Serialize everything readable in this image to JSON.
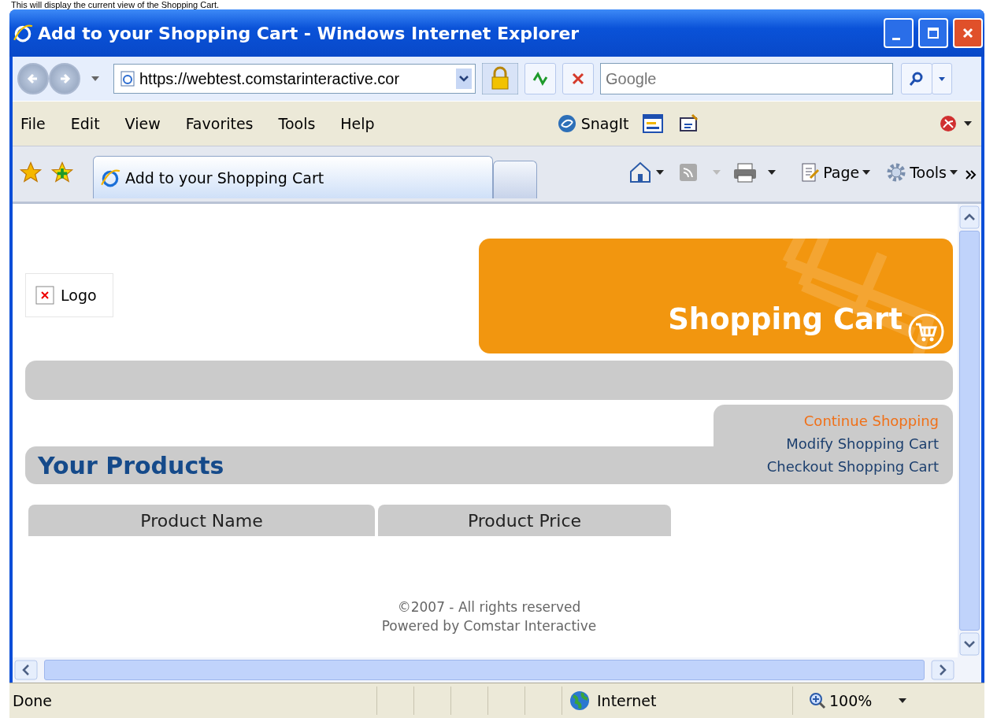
{
  "caption": "This will display the current view of the Shopping Cart.",
  "window": {
    "title": "Add to your Shopping Cart - Windows Internet Explorer"
  },
  "address_bar": {
    "url": "https://webtest.comstarinteractive.cor",
    "search_placeholder": "Google"
  },
  "menu": [
    "File",
    "Edit",
    "View",
    "Favorites",
    "Tools",
    "Help"
  ],
  "menu_tools": [
    {
      "kind": "snagit",
      "label": "SnagIt"
    }
  ],
  "tabs": [
    {
      "label": "Add to your Shopping Cart",
      "selected": true
    }
  ],
  "command_bar": [
    "Page",
    "Tools"
  ],
  "page": {
    "logo_alt": "Logo",
    "banner_title": "Shopping Cart",
    "links": [
      {
        "label": "Continue Shopping",
        "selected": true
      },
      {
        "label": "Modify Shopping Cart",
        "selected": false
      },
      {
        "label": "Checkout Shopping Cart",
        "selected": false
      }
    ],
    "section_title": "Your Products",
    "table": {
      "columns": [
        "Product Name",
        "Product Price"
      ]
    },
    "footer": [
      "©2007 - All rights reserved",
      "Powered by Comstar Interactive"
    ]
  },
  "status_bar": {
    "text": "Done",
    "zone": "Internet",
    "zoom": "100%"
  }
}
